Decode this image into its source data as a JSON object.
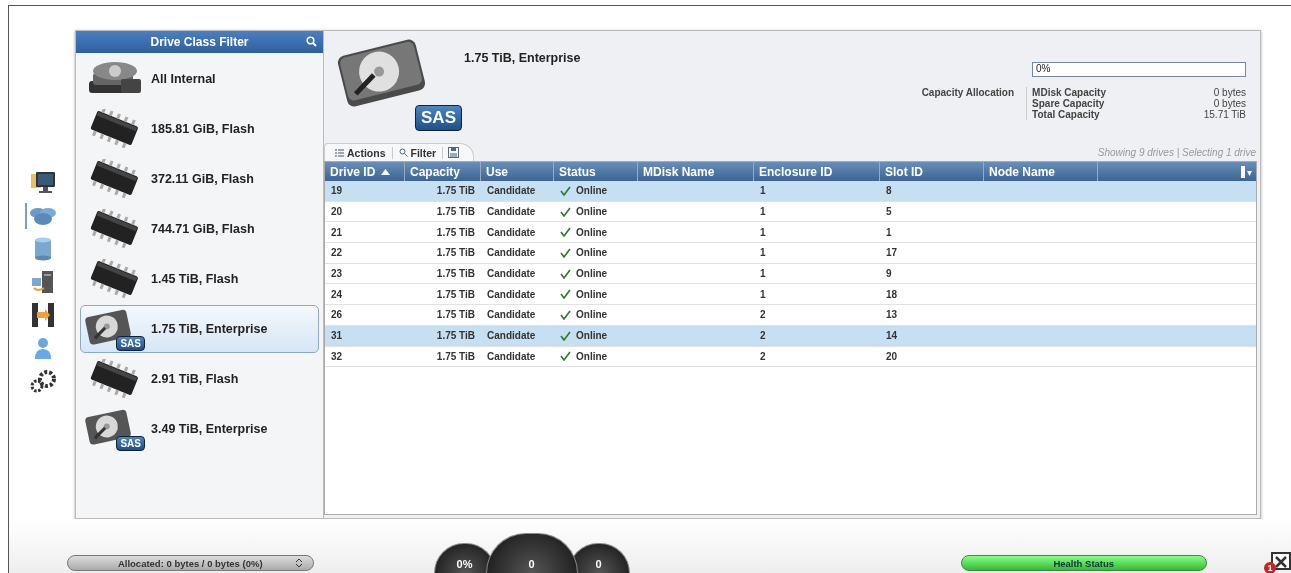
{
  "nav": [
    {
      "kind": "monitor",
      "selected": false
    },
    {
      "kind": "pools",
      "selected": true
    },
    {
      "kind": "volume",
      "selected": false
    },
    {
      "kind": "hosts",
      "selected": false
    },
    {
      "kind": "copy",
      "selected": false
    },
    {
      "kind": "user",
      "selected": false
    },
    {
      "kind": "settings",
      "selected": false
    }
  ],
  "filter": {
    "title": "Drive Class Filter",
    "items": [
      {
        "kind": "all",
        "label": "All Internal",
        "selected": false
      },
      {
        "kind": "flash",
        "label": "185.81 GiB, Flash",
        "selected": false
      },
      {
        "kind": "flash",
        "label": "372.11 GiB, Flash",
        "selected": false
      },
      {
        "kind": "flash",
        "label": "744.71 GiB, Flash",
        "selected": false
      },
      {
        "kind": "flash",
        "label": "1.45 TiB, Flash",
        "selected": false
      },
      {
        "kind": "sas",
        "label": "1.75 TiB, Enterprise",
        "badge": "SAS",
        "selected": true
      },
      {
        "kind": "flash",
        "label": "2.91 TiB, Flash",
        "selected": false
      },
      {
        "kind": "sas",
        "label": "3.49 TiB, Enterprise",
        "badge": "SAS",
        "selected": false
      }
    ]
  },
  "header": {
    "title": "1.75 TiB, Enterprise",
    "badge": "SAS",
    "allocation_label": "Capacity Allocation",
    "bar": {
      "level": 0,
      "text": "0%"
    },
    "capacities": [
      {
        "label": "MDisk Capacity",
        "value": "0 bytes"
      },
      {
        "label": "Spare Capacity",
        "value": "0 bytes"
      },
      {
        "label": "Total Capacity",
        "value": "15.71 TiB"
      }
    ]
  },
  "toolbar": {
    "actions": "Actions",
    "filter": "Filter",
    "summary": "Showing 9 drives | Selecting 1 drive"
  },
  "table": {
    "columns": [
      {
        "label": "Drive ID",
        "sorted": true
      },
      {
        "label": "Capacity",
        "sorted": false
      },
      {
        "label": "Use",
        "sorted": false
      },
      {
        "label": "Status",
        "sorted": false
      },
      {
        "label": "MDisk Name",
        "sorted": false
      },
      {
        "label": "Enclosure ID",
        "sorted": false
      },
      {
        "label": "Slot ID",
        "sorted": false
      },
      {
        "label": "Node Name",
        "sorted": false
      }
    ],
    "rows": [
      {
        "id": "19",
        "capacity": "1.75 TiB",
        "use": "Candidate",
        "status": "Online",
        "enclosure": "1",
        "slot": "8",
        "selected": true
      },
      {
        "id": "20",
        "capacity": "1.75 TiB",
        "use": "Candidate",
        "status": "Online",
        "enclosure": "1",
        "slot": "5",
        "selected": false
      },
      {
        "id": "21",
        "capacity": "1.75 TiB",
        "use": "Candidate",
        "status": "Online",
        "enclosure": "1",
        "slot": "1",
        "selected": false
      },
      {
        "id": "22",
        "capacity": "1.75 TiB",
        "use": "Candidate",
        "status": "Online",
        "enclosure": "1",
        "slot": "17",
        "selected": false
      },
      {
        "id": "23",
        "capacity": "1.75 TiB",
        "use": "Candidate",
        "status": "Online",
        "enclosure": "1",
        "slot": "9",
        "selected": false
      },
      {
        "id": "24",
        "capacity": "1.75 TiB",
        "use": "Candidate",
        "status": "Online",
        "enclosure": "1",
        "slot": "18",
        "selected": false
      },
      {
        "id": "26",
        "capacity": "1.75 TiB",
        "use": "Candidate",
        "status": "Online",
        "enclosure": "2",
        "slot": "13",
        "selected": false
      },
      {
        "id": "31",
        "capacity": "1.75 TiB",
        "use": "Candidate",
        "status": "Online",
        "enclosure": "2",
        "slot": "14",
        "selected": true
      },
      {
        "id": "32",
        "capacity": "1.75 TiB",
        "use": "Candidate",
        "status": "Online",
        "enclosure": "2",
        "slot": "20",
        "selected": false
      }
    ]
  },
  "status_bar": {
    "allocated": "Allocated: 0 bytes / 0 bytes (0%)",
    "gauges": [
      "0%",
      "0",
      "0"
    ],
    "health": "Health Status",
    "alerts": "1"
  }
}
